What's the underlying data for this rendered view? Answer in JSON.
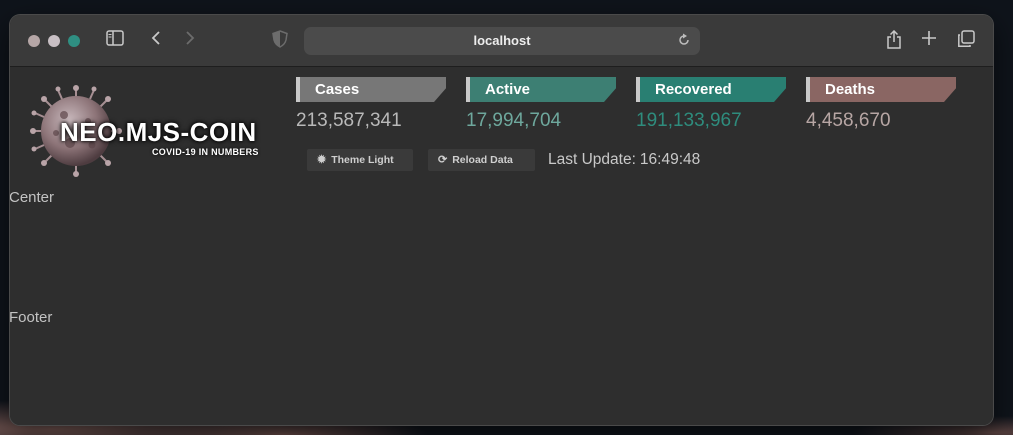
{
  "browser": {
    "url": "localhost",
    "colors": {
      "close": "#b5a6a6",
      "minimize": "#c8bfc4",
      "zoom": "#2f8f82"
    },
    "icons": {
      "sidebar": "sidebar-icon",
      "back": "chevron-left-icon",
      "forward": "chevron-right-icon",
      "privacy": "shield-icon",
      "reload": "reload-icon",
      "share": "share-icon",
      "new_tab": "plus-icon",
      "tabs": "tabs-overview-icon"
    }
  },
  "logo": {
    "title": "NEO.MJS-COIN",
    "subtitle": "COVID-19 IN NUMBERS"
  },
  "stats": [
    {
      "label": "Cases",
      "value": "213,587,341",
      "color": "#777777"
    },
    {
      "label": "Active",
      "value": "17,994,704",
      "color": "#3d7f73"
    },
    {
      "label": "Recovered",
      "value": "191,133,967",
      "color": "#297f72"
    },
    {
      "label": "Deaths",
      "value": "4,458,670",
      "color": "#8a6663"
    }
  ],
  "controls": {
    "theme_button": {
      "label": "Theme Light",
      "icon": "sun-icon"
    },
    "reload_button": {
      "label": "Reload Data",
      "icon": "sync-icon"
    },
    "last_update_label": "Last Update:",
    "last_update_value": "16:49:48"
  },
  "regions": {
    "center": "Center",
    "footer": "Footer"
  }
}
